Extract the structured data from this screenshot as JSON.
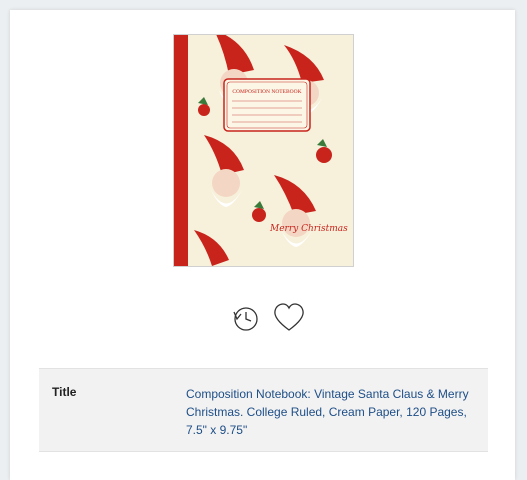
{
  "book": {
    "cover_title": "COMPOSITION NOTEBOOK",
    "cover_lettering": "Merry Christmas",
    "details": {
      "title_label": "Title",
      "title_value": "Composition Notebook: Vintage Santa Claus & Merry Christmas. College Ruled, Cream Paper, 120 Pages, 7.5\" x 9.75\""
    }
  },
  "colors": {
    "card_bg": "#ffffff",
    "page_bg": "#eceff1",
    "link": "#1e4e87",
    "cover_red": "#c8241c",
    "cover_cream": "#f7f1dc"
  },
  "icons": [
    "history-icon",
    "heart-icon"
  ]
}
